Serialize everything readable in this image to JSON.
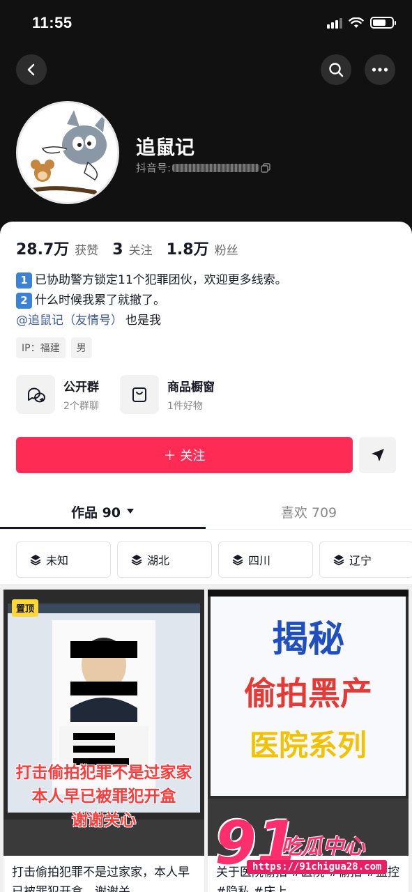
{
  "status_bar": {
    "time": "11:55"
  },
  "profile": {
    "nickname": "追鼠记",
    "douyin_id_label": "抖音号:",
    "stats": [
      {
        "value": "28.7万",
        "label": "获赞"
      },
      {
        "value": "3",
        "label": "关注"
      },
      {
        "value": "1.8万",
        "label": "粉丝"
      }
    ],
    "bio": {
      "line1_badge": "1",
      "line1": "已协助警方锁定11个犯罪团伙，欢迎更多线索。",
      "line2_badge": "2",
      "line2": "什么时候我累了就撤了。",
      "mention": "@追鼠记（友情号）",
      "line3_suffix": "也是我"
    },
    "tags": [
      "IP：福建",
      "男"
    ],
    "entries": [
      {
        "title": "公开群",
        "subtitle": "2个群聊",
        "icon": "chat-bubbles-icon"
      },
      {
        "title": "商品橱窗",
        "subtitle": "1件好物",
        "icon": "shopping-bag-icon"
      }
    ],
    "follow_label": "＋ 关注"
  },
  "tabs": {
    "works": "作品 90",
    "likes": "喜欢 709"
  },
  "collections": [
    "未知",
    "湖北",
    "四川",
    "辽宁"
  ],
  "videos": [
    {
      "pinned": "置顶",
      "overlay_line1": "打击偷拍犯罪不是过家家",
      "overlay_line2": "本人早已被罪犯开盒",
      "overlay_line3": "谢谢关心",
      "title": "打击偷拍犯罪不是过家家，本人早已被罪犯开盒，谢谢关"
    },
    {
      "overlay_line1": "揭秘",
      "overlay_line2": "偷拍黑产",
      "overlay_line3": "医院系列",
      "title": "关于医院偷拍 #医院 #偷拍 #监控 #隐私 #床上"
    }
  ],
  "watermark": {
    "number": "91",
    "text": "吃瓜中心",
    "url": "https://91chigua28.com"
  },
  "colors": {
    "accent": "#fe2c55",
    "mention": "#3d5b96",
    "dark_bg": "#111111"
  }
}
